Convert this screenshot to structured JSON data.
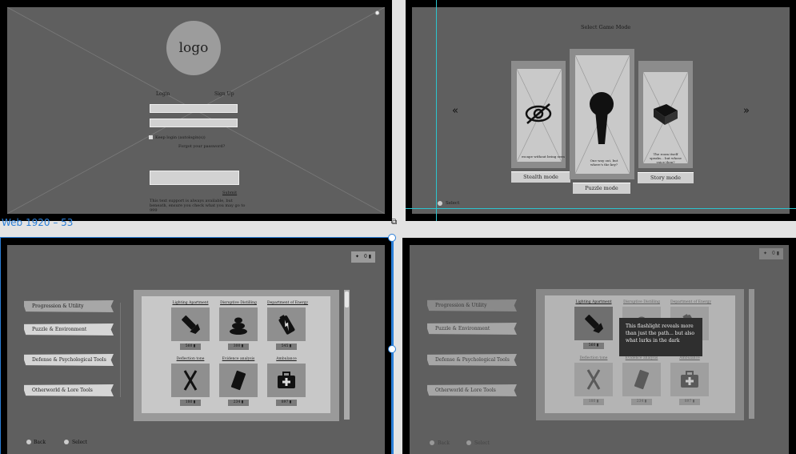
{
  "frame_label": "Web 1920 – 53",
  "login": {
    "logo_text": "logo",
    "tab_login": "Login",
    "tab_signup": "Sign Up",
    "keep_logged": "Keep login (autologin(s))",
    "forgot": "Forgot your password?",
    "submit": "Submit",
    "footer_text": "This text support is always available, but beneath, ensure you check what you may go to 999"
  },
  "game_mode": {
    "title": "Select Game Mode",
    "left_arrow": "«",
    "right_arrow": "»",
    "modes": [
      {
        "label": "Stealth mode",
        "caption": "escape without being seen"
      },
      {
        "label": "Puzzle mode",
        "caption": "One way out, but where's the key?"
      },
      {
        "label": "Story mode",
        "caption": "The room itself speaks... but whose voice then?"
      }
    ],
    "select_hint": "Select"
  },
  "inventory": {
    "currency": "0",
    "categories": [
      "Progression & Utility",
      "Puzzle & Environment",
      "Defense & Psychological Tools",
      "Otherworld & Lore Tools"
    ],
    "items": [
      {
        "name": "Lighting Apartment",
        "price": "560",
        "icon": "flashlight-icon"
      },
      {
        "name": "Disruptive Distilling",
        "price": "300",
        "icon": "poop-icon"
      },
      {
        "name": "Department of Energy",
        "price": "545",
        "icon": "battery-icon"
      },
      {
        "name": "Deflection tone",
        "price": "180",
        "icon": "crossed-sticks-icon"
      },
      {
        "name": "Evidence analysis",
        "price": "234",
        "icon": "phone-icon"
      },
      {
        "name": "Ambulance",
        "price": "897",
        "icon": "first-aid-icon"
      }
    ],
    "back_hint": "Back",
    "select_hint": "Select",
    "tooltip": "This flashlight reveals more than just the path... but also what lurks in the dark"
  }
}
